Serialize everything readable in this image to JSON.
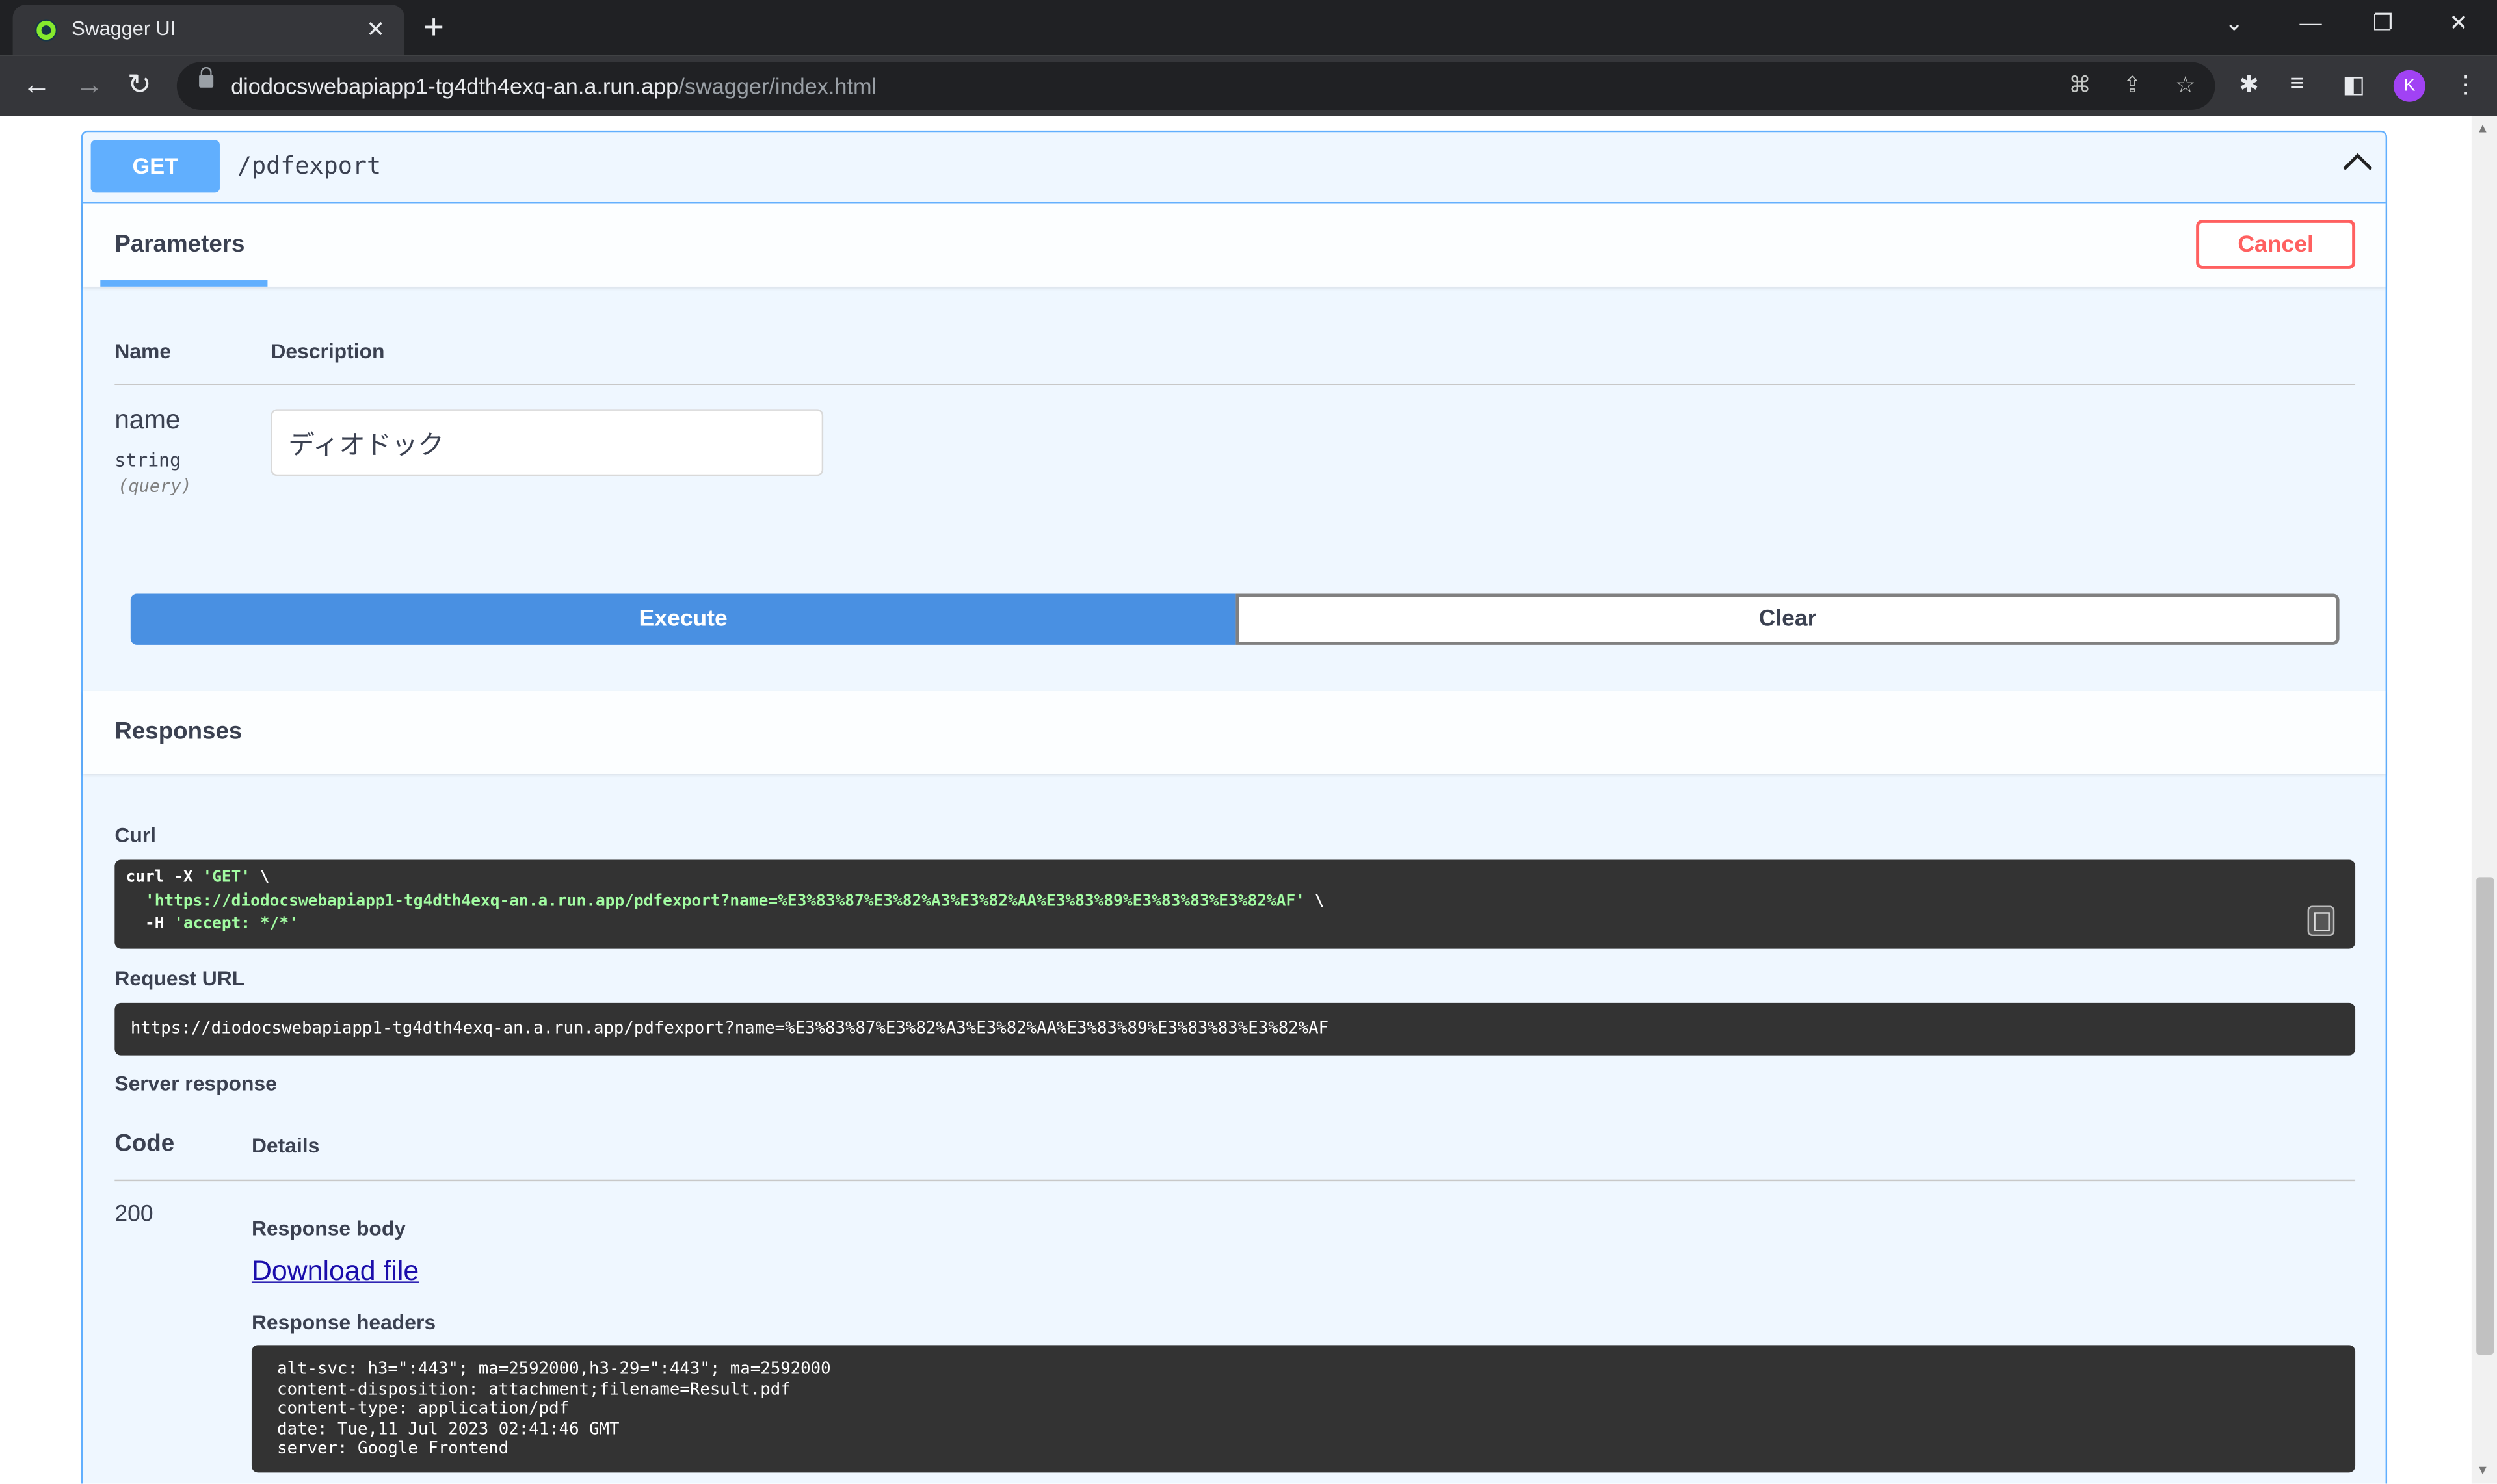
{
  "browser": {
    "tab_title": "Swagger UI",
    "url_host": "diodocswebapiapp1-tg4dth4exq-an.a.run.app",
    "url_path": "/swagger/index.html",
    "profile_initial": "K"
  },
  "operation": {
    "method": "GET",
    "path": "/pdfexport",
    "parameters_tab": "Parameters",
    "cancel_label": "Cancel",
    "columns": {
      "name": "Name",
      "description": "Description"
    },
    "param": {
      "name": "name",
      "type": "string",
      "in": "(query)",
      "value": "ディオドック"
    },
    "execute_label": "Execute",
    "clear_label": "Clear"
  },
  "responses": {
    "title": "Responses",
    "curl_label": "Curl",
    "curl_lines": {
      "l1_cmd": "curl -X ",
      "l1_method": "'GET'",
      "l1_tail": " \\",
      "l2_url": "  'https://diodocswebapiapp1-tg4dth4exq-an.a.run.app/pdfexport?name=%E3%83%87%E3%82%A3%E3%82%AA%E3%83%89%E3%83%83%E3%82%AF'",
      "l2_tail": " \\",
      "l3_flag": "  -H ",
      "l3_val": "'accept: */*'"
    },
    "request_url_label": "Request URL",
    "request_url": "https://diodocswebapiapp1-tg4dth4exq-an.a.run.app/pdfexport?name=%E3%83%87%E3%82%A3%E3%82%AA%E3%83%89%E3%83%83%E3%82%AF",
    "server_response_label": "Server response",
    "code_header": "Code",
    "details_header": "Details",
    "status_code": "200",
    "response_body_label": "Response body",
    "download_label": "Download file",
    "response_headers_label": "Response headers",
    "headers": [
      "alt-svc: h3=\":443\"; ma=2592000,h3-29=\":443\"; ma=2592000",
      "content-disposition: attachment;filename=Result.pdf",
      "content-type: application/pdf",
      "date: Tue,11 Jul 2023 02:41:46 GMT",
      "server: Google Frontend"
    ]
  },
  "colors": {
    "get_blue": "#61affe",
    "cancel_red": "#ff6060",
    "execute_blue": "#4990e2"
  }
}
